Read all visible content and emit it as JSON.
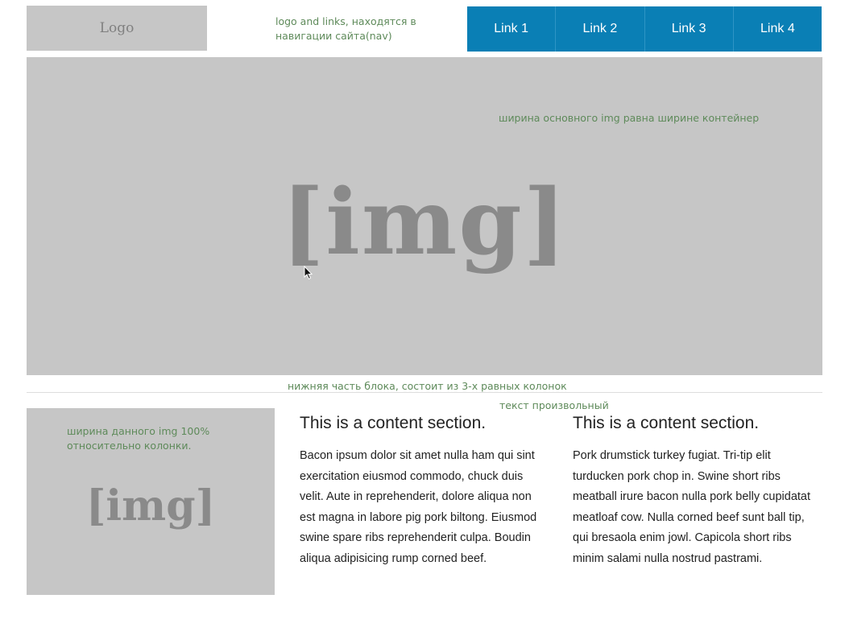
{
  "header": {
    "logo_label": "Logo",
    "nav_note": "logo and links, находятся в навигации сайта(nav)",
    "nav_links": [
      "Link 1",
      "Link 2",
      "Link 3",
      "Link 4"
    ]
  },
  "hero": {
    "note": "ширина основного img равна ширине контейнер",
    "image_label": "[img]"
  },
  "lower": {
    "note": "нижняя часть блока, состоит из 3-х равных колонок",
    "text_note": "текст произвольный"
  },
  "columns": [
    {
      "image_label": "[img]",
      "note": "ширина данного img 100% относительно колонки."
    },
    {
      "title": "This is a content section.",
      "body": "Bacon ipsum dolor sit amet nulla ham qui sint exercitation eiusmod commodo, chuck duis velit. Aute in reprehenderit, dolore aliqua non est magna in labore pig pork biltong. Eiusmod swine spare ribs reprehenderit culpa. Boudin aliqua adipisicing rump corned beef."
    },
    {
      "title": "This is a content section.",
      "body": "Pork drumstick turkey fugiat. Tri-tip elit turducken pork chop in. Swine short ribs meatball irure bacon nulla pork belly cupidatat meatloaf cow. Nulla corned beef sunt ball tip, qui bresaola enim jowl. Capicola short ribs minim salami nulla nostrud pastrami."
    }
  ],
  "colors": {
    "nav_background": "#0a7fb5",
    "placeholder_gray": "#c6c6c6",
    "annotation_green": "#5e8a5a"
  }
}
